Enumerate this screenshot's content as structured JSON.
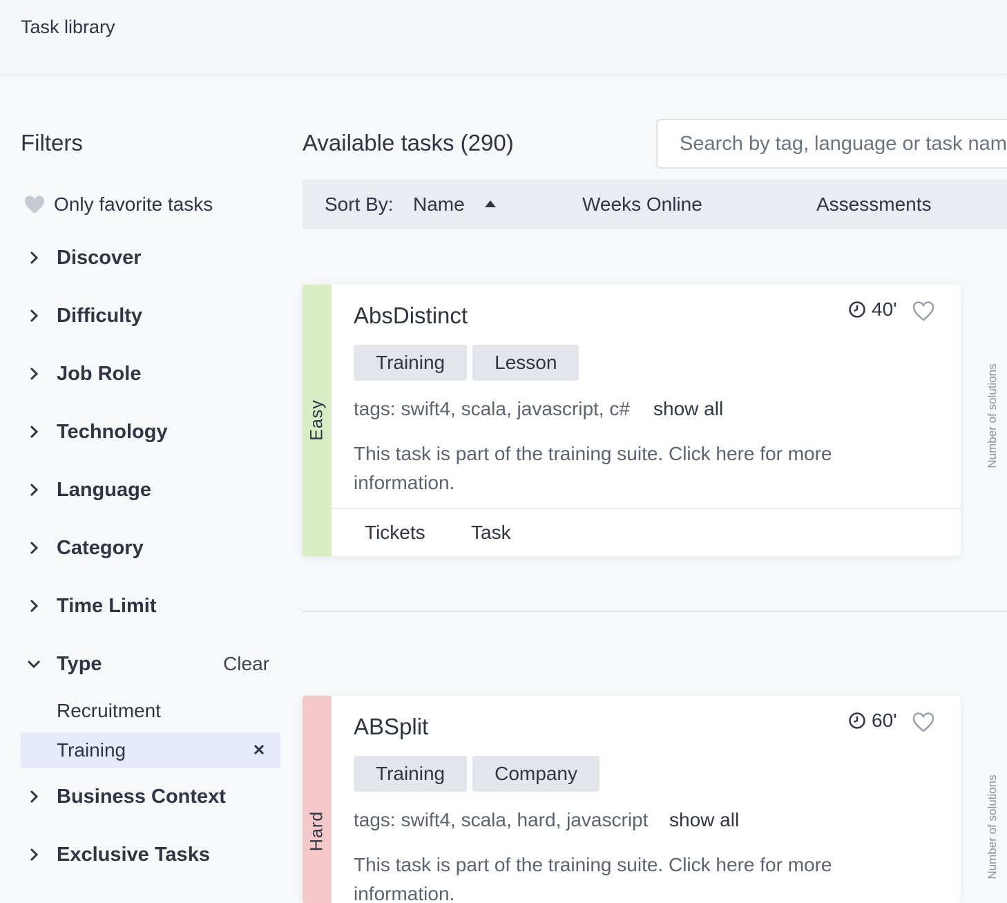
{
  "header": {
    "title": "Task library"
  },
  "filters": {
    "title": "Filters",
    "favorite_label": "Only favorite tasks",
    "groups": {
      "discover": "Discover",
      "difficulty": "Difficulty",
      "job_role": "Job Role",
      "technology": "Technology",
      "language": "Language",
      "category": "Category",
      "time_limit": "Time Limit",
      "type": "Type",
      "business_context": "Business Context",
      "exclusive_tasks": "Exclusive Tasks"
    },
    "type_clear": "Clear",
    "type_options": [
      "Recruitment",
      "Training"
    ],
    "type_selected": "Training"
  },
  "main": {
    "title": "Available tasks (290)",
    "search_placeholder": "Search by tag, language or task name",
    "sort": {
      "label": "Sort By:",
      "name": "Name",
      "weeks_online": "Weeks Online",
      "assessments": "Assessments"
    }
  },
  "tasks": [
    {
      "difficulty": "Easy",
      "difficulty_color": "#d9edc5",
      "name": "AbsDistinct",
      "time": "40'",
      "badges": [
        "Training",
        "Lesson"
      ],
      "tags": "tags: swift4, scala, javascript, c#",
      "show_all": "show all",
      "description": "This task is part of the training suite. Click here for more information.",
      "footer": [
        "Tickets",
        "Task"
      ],
      "side_label": "Number of solutions"
    },
    {
      "difficulty": "Hard",
      "difficulty_color": "#f5c9c9",
      "name": "ABSplit",
      "time": "60'",
      "badges": [
        "Training",
        "Company"
      ],
      "tags": "tags: swift4, scala, hard, javascript",
      "show_all": "show all",
      "description": "This task is part of the training suite. Click here for more information.",
      "side_label": "Number of solutions"
    }
  ],
  "colors": {
    "selected_filter_bg": "#e6e9fb",
    "sort_bar_bg": "#e9ecf1",
    "badge_bg": "#e2e5ea",
    "easy": "#d9edc5",
    "hard": "#f5c9c9"
  },
  "icons": {
    "favorite": "heart-icon",
    "expand": "chevron-right-icon",
    "collapse": "chevron-down-icon",
    "remove": "close-icon",
    "sort": "sort-ascending-icon",
    "time": "clock-icon"
  }
}
